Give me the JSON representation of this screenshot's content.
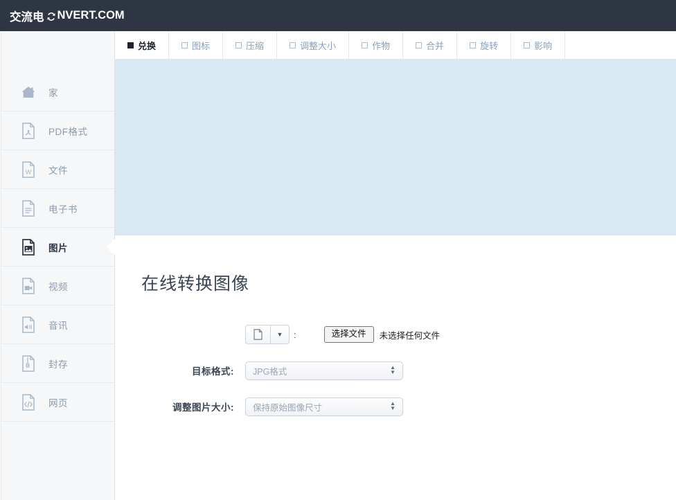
{
  "header": {
    "logo_cn": "交流电",
    "logo_icon": "convert-refresh-icon",
    "logo_text": "NVERT.COM",
    "background_color": "#2d3642"
  },
  "tabs": [
    {
      "label": "兑换",
      "active": true,
      "marker": "filled-square"
    },
    {
      "label": "图标",
      "active": false,
      "marker": "empty-square"
    },
    {
      "label": "压缩",
      "active": false,
      "marker": "empty-square"
    },
    {
      "label": "调整大小",
      "active": false,
      "marker": "empty-square"
    },
    {
      "label": "作物",
      "active": false,
      "marker": "empty-square"
    },
    {
      "label": "合并",
      "active": false,
      "marker": "empty-square"
    },
    {
      "label": "旋转",
      "active": false,
      "marker": "empty-square"
    },
    {
      "label": "影响",
      "active": false,
      "marker": "empty-square"
    }
  ],
  "sidebar": {
    "items": [
      {
        "label": "家",
        "icon": "home-icon",
        "active": false
      },
      {
        "label": "PDF格式",
        "icon": "pdf-file-icon",
        "active": false
      },
      {
        "label": "文件",
        "icon": "word-document-icon",
        "active": false
      },
      {
        "label": "电子书",
        "icon": "ebook-file-icon",
        "active": false
      },
      {
        "label": "图片",
        "icon": "image-file-icon",
        "active": true
      },
      {
        "label": "视频",
        "icon": "video-file-icon",
        "active": false
      },
      {
        "label": "音讯",
        "icon": "audio-file-icon",
        "active": false
      },
      {
        "label": "封存",
        "icon": "archive-file-icon",
        "active": false
      },
      {
        "label": "网页",
        "icon": "code-file-icon",
        "active": false
      }
    ]
  },
  "banner": {
    "background_color": "#d8e9f4"
  },
  "main": {
    "title": "在线转换图像",
    "source_row": {
      "filetype_icon": "file-icon",
      "caret_icon": "chevron-down-icon",
      "separator": ":",
      "choose_button": "选择文件",
      "file_status": "未选择任何文件"
    },
    "target_format": {
      "label": "目标格式:",
      "value": "JPG格式"
    },
    "resize": {
      "label": "调整图片大小:",
      "value": "保持原始图像尺寸"
    }
  }
}
